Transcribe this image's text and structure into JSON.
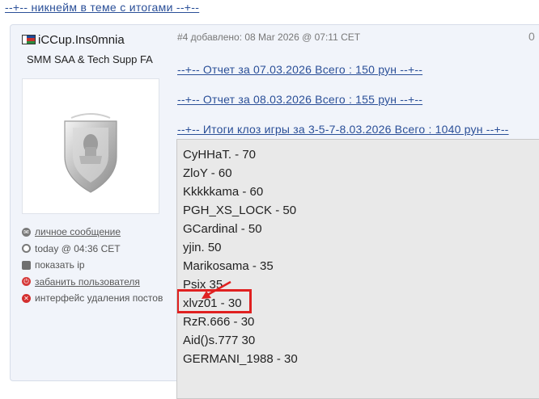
{
  "topbar": {
    "link_text": "--+-- никнейм в теме с итогами --+--"
  },
  "post": {
    "username": "iCCup.Ins0mnia",
    "user_title": "SMM SAA & Tech Supp FA",
    "meta": "#4 добавлено: 08 Mar 2026 @ 07:11 CET",
    "post_counter": "0",
    "user_links": [
      {
        "label": "личное сообщение",
        "icon": "envelope-icon"
      },
      {
        "label": "today @ 04:36 CET",
        "icon": "clock-icon"
      },
      {
        "label": "показать ip",
        "icon": "ip-icon"
      },
      {
        "label": "забанить пользователя",
        "icon": "ban-icon"
      },
      {
        "label": "интерфейс удаления постов",
        "icon": "delete-icon"
      }
    ],
    "report_links": [
      "--+-- Отчет за 07.03.2026 Всего : 150 рун --+--",
      "--+-- Отчет за 08.03.2026 Всего : 155 рун --+--",
      "--+-- Итоги клоз игры за 3-5-7-8.03.2026 Всего : 1040 рун --+--"
    ],
    "results": [
      "CyHHaT. - 70",
      "ZloY - 60",
      "Kkkkkama - 60",
      "PGH_XS_LOCK - 50",
      "GCardinal - 50",
      "yjin. 50",
      "Marikosama - 35",
      "Psix 35",
      "xlvz01 - 30",
      "RzR.666 - 30",
      "Aid()s.777 30",
      "GERMANI_1988 - 30"
    ],
    "highlighted_entry_index": 8,
    "highlight_color": "#e02020"
  }
}
